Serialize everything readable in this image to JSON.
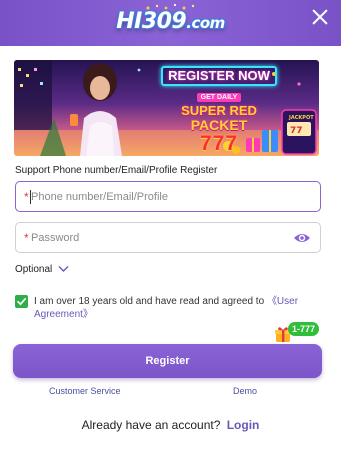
{
  "header": {
    "logo_main": "HI309",
    "logo_suffix": ".com",
    "close_icon": "close-icon"
  },
  "banner": {
    "register_now": "REGISTER NOW",
    "get_daily": "GET DAILY",
    "super_red": "SUPER RED",
    "packet": "PACKET",
    "amount": "777"
  },
  "form": {
    "support_label": "Support Phone number/Email/Profile Register",
    "account_placeholder": "Phone number/Email/Profile",
    "password_placeholder": "Password",
    "required_mark": "*",
    "optional_label": "Optional",
    "agreement_text": "I am over 18 years old and have read and agreed to",
    "agreement_link": "《User Agreement》",
    "checkbox_checked": true,
    "bonus_badge": "1-777",
    "register_label": "Register"
  },
  "footer": {
    "customer_service": "Customer Service",
    "demo": "Demo",
    "have_account": "Already have an account?",
    "login": "Login"
  },
  "colors": {
    "accent": "#8a63d6",
    "header": "#7a52c8",
    "link": "#6a58b8",
    "checkbox": "#2fae4a",
    "required": "#e23a3a"
  }
}
